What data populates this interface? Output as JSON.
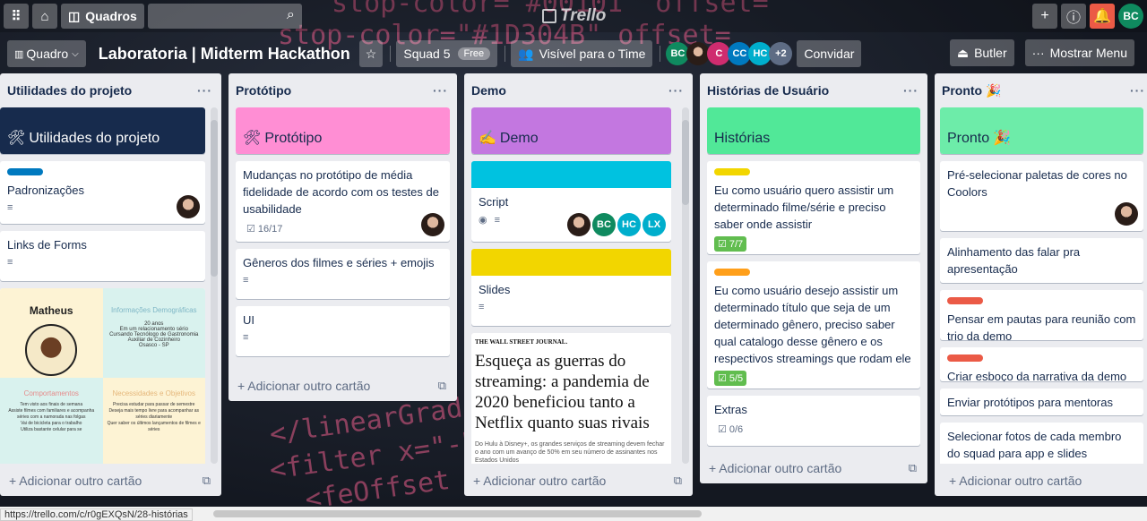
{
  "header": {
    "boards_label": "Quadros",
    "logo_text": "Trello",
    "user_initials": "BC"
  },
  "board": {
    "view_label": "Quadro",
    "title": "Laboratoria | Midterm Hackathon",
    "team_name": "Squad 5",
    "team_badge": "Free",
    "visibility_label": "Visível para o Time",
    "members": [
      {
        "initials": "BC",
        "color": "#0f8a5f"
      },
      {
        "initials": "",
        "color": "#c9a27e"
      },
      {
        "initials": "C",
        "color": "#cf2c6f"
      },
      {
        "initials": "CC",
        "color": "#0079bf"
      },
      {
        "initials": "HC",
        "color": "#00aecc"
      }
    ],
    "more_members": "+2",
    "invite_label": "Convidar",
    "butler_label": "Butler",
    "menu_label": "Mostrar Menu"
  },
  "add_card_label": "Adicionar outro cartão",
  "lists": [
    {
      "title": "Utilidades do projeto",
      "cover_title": "Utilidades do projeto",
      "cover_emoji": "🛠",
      "cards": [
        {
          "title": "Padronizações"
        },
        {
          "title": "Links de Forms"
        }
      ],
      "persona": {
        "name": "Matheus",
        "info_title": "Informações Demográficas",
        "info_lines": [
          "20 anos",
          "Em um relacionamento sério",
          "Cursando Tecnólogo de Gastronomia",
          "Auxiliar de Cozinheiro",
          "Osasco - SP"
        ],
        "behaviors_title": "Comportamentos",
        "behaviors_lines": [
          "Tem visto aos finais de semana",
          "Assiste filmes com familiares e acompanha séries com a namorada nas folgas",
          "Vai de bicicleta para o trabalho",
          "Utiliza bastante celular para se"
        ],
        "needs_title": "Necessidades e Objetivos",
        "needs_lines": [
          "Precisa estudar para passar de semestre",
          "Deseja mais tempo livre para acompanhar as séries diariamente",
          "Quer saber os últimos lançamentos de filmes e séries"
        ]
      }
    },
    {
      "title": "Protótipo",
      "cover_title": "Protótipo",
      "cover_emoji": "🛠",
      "cards": [
        {
          "title": "Mudanças no protótipo de média fidelidade de acordo com os testes de usabilidade",
          "checklist": "16/17"
        },
        {
          "title": "Gêneros dos filmes e séries + emojis"
        },
        {
          "title": "UI"
        }
      ]
    },
    {
      "title": "Demo",
      "cover_title": "Demo",
      "cover_emoji": "✍",
      "cards": [
        {
          "title": "Script",
          "members": [
            "BC",
            "HC",
            "LX"
          ]
        },
        {
          "title": "Slides"
        }
      ],
      "article": {
        "source": "THE WALL STREET JOURNAL.",
        "headline": "Esqueça as guerras do streaming: a pandemia de 2020 beneficiou tanto a Netflix quanto suas rivais",
        "summary": "Do Hulu à Disney+, os grandes serviços de streaming devem fechar o ano com um avanço de 50% em seu número de assinantes nos Estados Unidos"
      }
    },
    {
      "title": "Histórias de Usuário",
      "cover_title": "Histórias",
      "cards": [
        {
          "title": "Eu como usuário quero assistir um determinado filme/série e preciso saber onde assistir",
          "checklist": "7/7"
        },
        {
          "title": "Eu como usuário desejo assistir um determinado título que seja de um determinado gênero, preciso saber qual catalogo desse gênero e os respectivos streamings que rodam ele",
          "checklist": "5/5"
        },
        {
          "title": "Extras",
          "checklist": "0/6"
        }
      ]
    },
    {
      "title": "Pronto",
      "title_emoji": "🎉",
      "cover_title": "Pronto",
      "cover_emoji": "🎉",
      "cards": [
        {
          "title": "Pré-selecionar paletas de cores no Coolors"
        },
        {
          "title": "Alinhamento das falar pra apresentação"
        },
        {
          "title": "Pensar em pautas para reunião com trio da demo"
        },
        {
          "title": "Criar esboço da narrativa da demo"
        },
        {
          "title": "Enviar protótipos para mentoras"
        },
        {
          "title": "Selecionar fotos de cada membro do squad para app e slides"
        }
      ]
    }
  ],
  "status_url": "https://trello.com/c/r0gEXQsN/28-histórias",
  "colors": {
    "list_bg": "#ebecf0",
    "cover_utilidades": "#172b4d",
    "cover_prototipo": "#ff8ed4",
    "cover_demo": "#c377e0",
    "cover_historias": "#51e898",
    "cover_pronto": "#6deca9",
    "label_blue": "#0079bf",
    "label_yellow": "#f2d600",
    "label_orange": "#ff9f1a",
    "label_red": "#eb5a46",
    "label_sky": "#00c2e0",
    "checklist_done": "#61bd4f"
  }
}
